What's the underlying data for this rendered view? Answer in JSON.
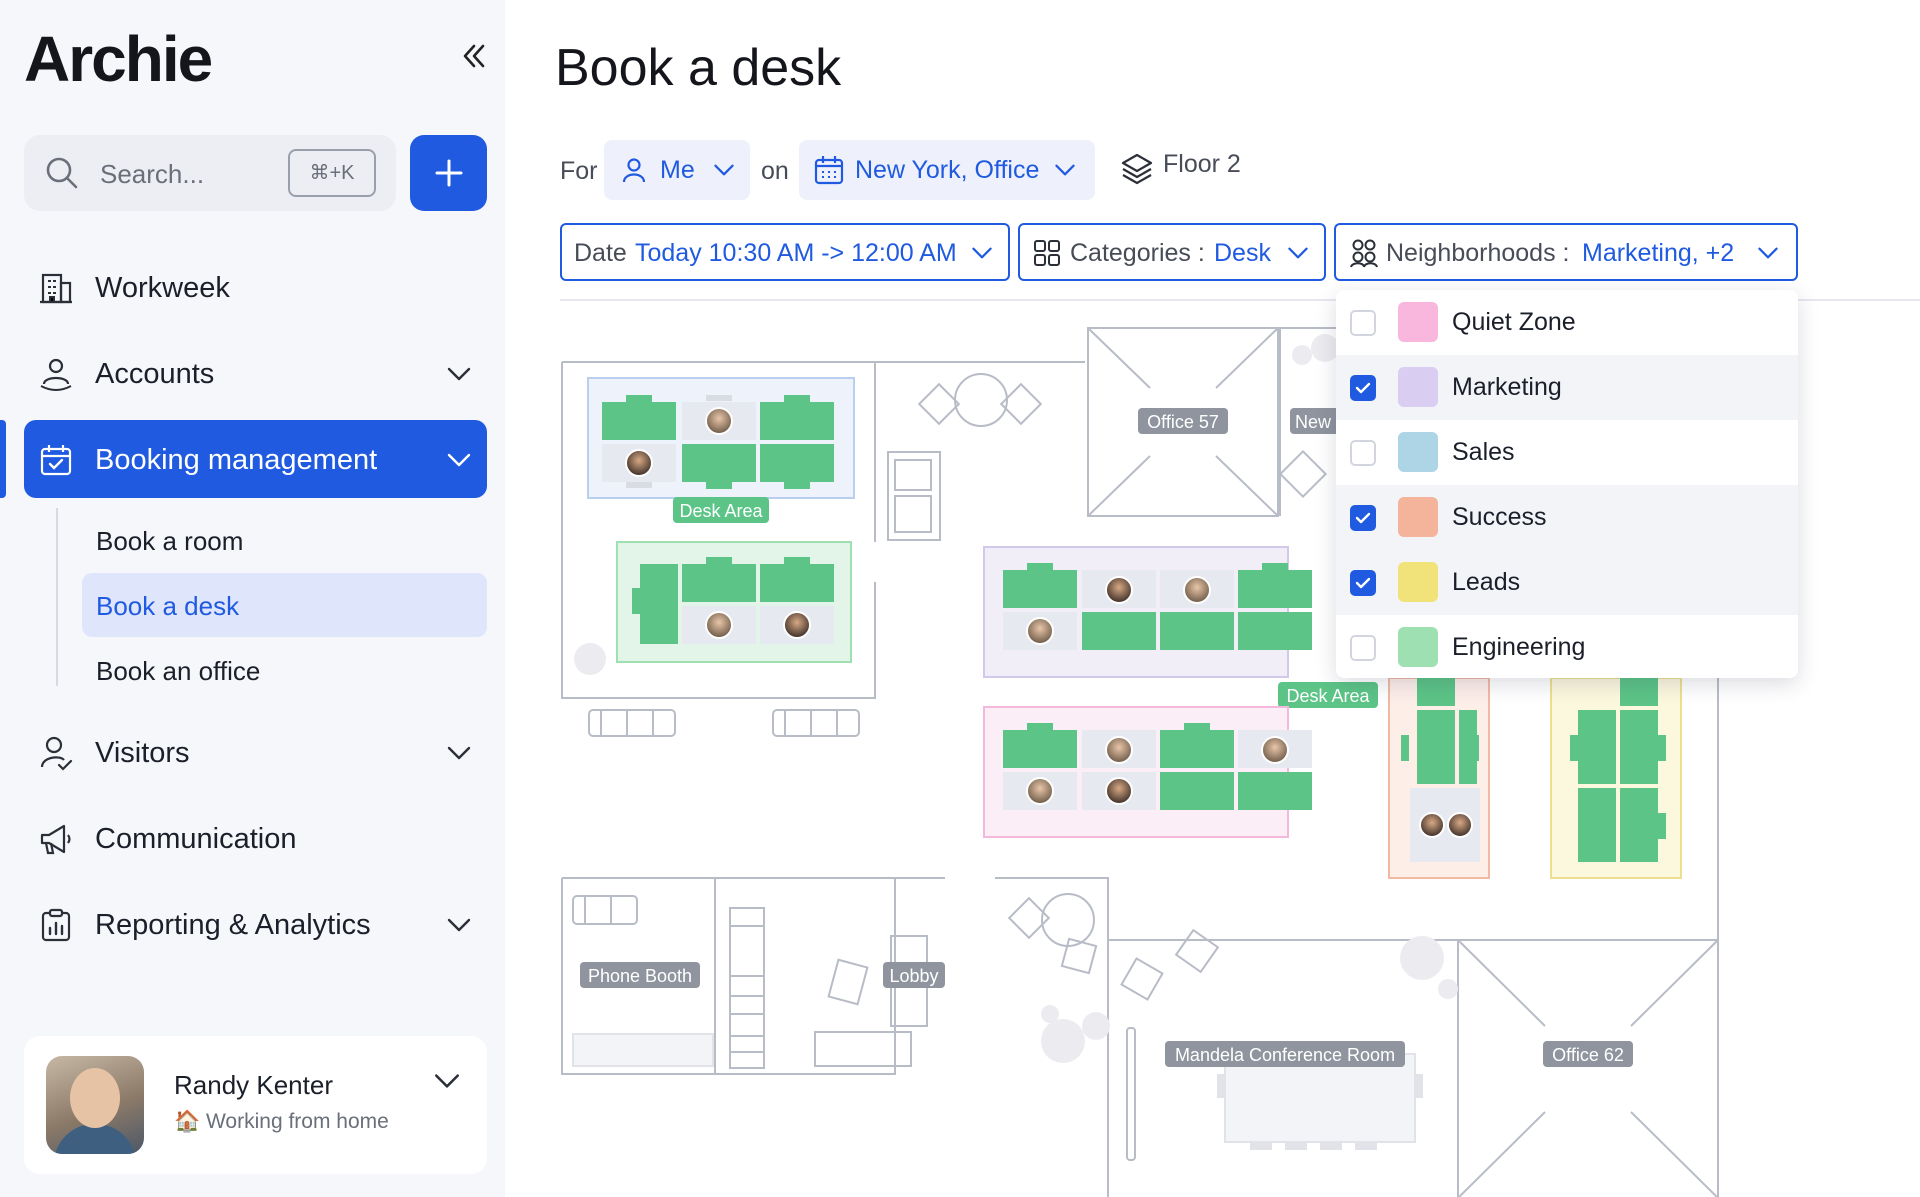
{
  "app": {
    "logo": "Archie"
  },
  "search": {
    "placeholder": "Search...",
    "shortcut": "⌘+K"
  },
  "nav": {
    "items": [
      {
        "label": "Workweek",
        "icon": "building-icon"
      },
      {
        "label": "Accounts",
        "icon": "accounts-icon"
      },
      {
        "label": "Booking management",
        "icon": "calendar-check-icon"
      },
      {
        "label": "Visitors",
        "icon": "visitor-icon"
      },
      {
        "label": "Communication",
        "icon": "megaphone-icon"
      },
      {
        "label": "Reporting & Analytics",
        "icon": "clipboard-icon"
      }
    ],
    "booking_sub": [
      "Book a room",
      "Book a desk",
      "Book an office"
    ]
  },
  "user": {
    "name": "Randy Kenter",
    "status": "Working from home"
  },
  "page": {
    "title": "Book a desk"
  },
  "filters": {
    "for_label": "For",
    "for_value": "Me",
    "on_label": "on",
    "location_value": "New York, Office",
    "floor": "Floor 2",
    "date_key": "Date",
    "date_value": "Today 10:30 AM -> 12:00 AM",
    "categories_key": "Categories :",
    "categories_value": "Desk",
    "neighborhoods_key": "Neighborhoods :",
    "neighborhoods_value": "Marketing, +2"
  },
  "neighborhoods": [
    {
      "label": "Quiet Zone",
      "checked": false,
      "color": "#f9b7de"
    },
    {
      "label": "Marketing",
      "checked": true,
      "color": "#d9cdf2"
    },
    {
      "label": "Sales",
      "checked": false,
      "color": "#add5e6"
    },
    {
      "label": "Success",
      "checked": true,
      "color": "#f4b49c"
    },
    {
      "label": "Leads",
      "checked": true,
      "color": "#f2e27a"
    },
    {
      "label": "Engineering",
      "checked": false,
      "color": "#9fe0b2"
    }
  ],
  "plan_labels": {
    "desk_area_1": "Desk Area",
    "desk_area_2": "Desk Area",
    "office_57": "Office 57",
    "new": "New",
    "phone_booth": "Phone Booth",
    "lobby": "Lobby",
    "conference": "Mandela Conference Room",
    "office_62": "Office 62"
  },
  "colors": {
    "accent": "#1f5ae0",
    "desk": "#5cc487"
  }
}
